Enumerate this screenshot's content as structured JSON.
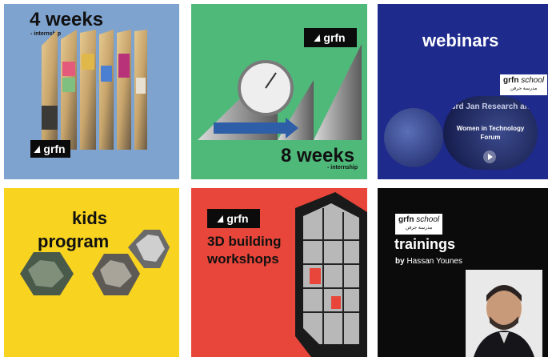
{
  "tiles": {
    "internship1": {
      "title": "4 weeks",
      "subtitle": "- internship",
      "logo": "grfn"
    },
    "internship2": {
      "title": "8 weeks",
      "subtitle": "- internship",
      "logo": "grfn"
    },
    "webinars": {
      "title": "webinars",
      "school_brand": "grfn",
      "school_word": "school",
      "school_arabic": "مدرسة جرفن",
      "event_line1": "Women in Technology",
      "event_line2": "Forum",
      "backdrop_text": "3rd Jan Research and Innovation"
    },
    "kids": {
      "title_line1": "kids",
      "title_line2": "program"
    },
    "workshops": {
      "logo": "grfn",
      "title_line1": "3D building",
      "title_line2": "workshops"
    },
    "trainings": {
      "school_brand": "grfn",
      "school_word": "school",
      "school_arabic": "مدرسة جرفن",
      "title": "trainings",
      "by_label": "by",
      "instructor": "Hassan Younes"
    }
  },
  "colors": {
    "internship1_bg": "#7fa3cf",
    "internship2_bg": "#4fb97a",
    "webinars_bg": "#1e2a8c",
    "kids_bg": "#f8d31f",
    "workshops_bg": "#e8463a",
    "trainings_bg": "#0b0b0b"
  }
}
